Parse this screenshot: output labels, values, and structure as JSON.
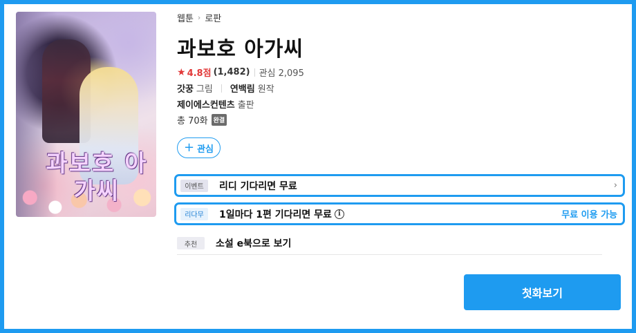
{
  "breadcrumb": {
    "category": "웹툰",
    "genre": "로판"
  },
  "book": {
    "title": "과보호 아가씨",
    "cover_title": "과보호 아가씨",
    "rating_score": "4.8점",
    "rating_count": "(1,482)",
    "interest": "관심 2,095",
    "illustrator": "갓꿍",
    "illustrator_role": "그림",
    "author": "연백림",
    "author_role": "원작",
    "publisher": "제이에스컨텐츠",
    "publisher_role": "출판",
    "episodes": "총 70화",
    "status_badge": "완결"
  },
  "buttons": {
    "add_interest": "관심",
    "read_first": "첫화보기"
  },
  "promos": [
    {
      "tag": "이벤트",
      "text": "리디 기다리면 무료",
      "right_icon": "chevron-right-icon"
    },
    {
      "tag": "리다무",
      "text": "1일마다 1편 기다리면 무료",
      "info_icon": "info-icon",
      "right_text": "무료 이용 가능"
    },
    {
      "tag": "추천",
      "text": "소설 e북으로 보기"
    }
  ],
  "colors": {
    "accent": "#1e9bf0",
    "rating": "#e23a3a",
    "badge": "#6b6b6b"
  }
}
